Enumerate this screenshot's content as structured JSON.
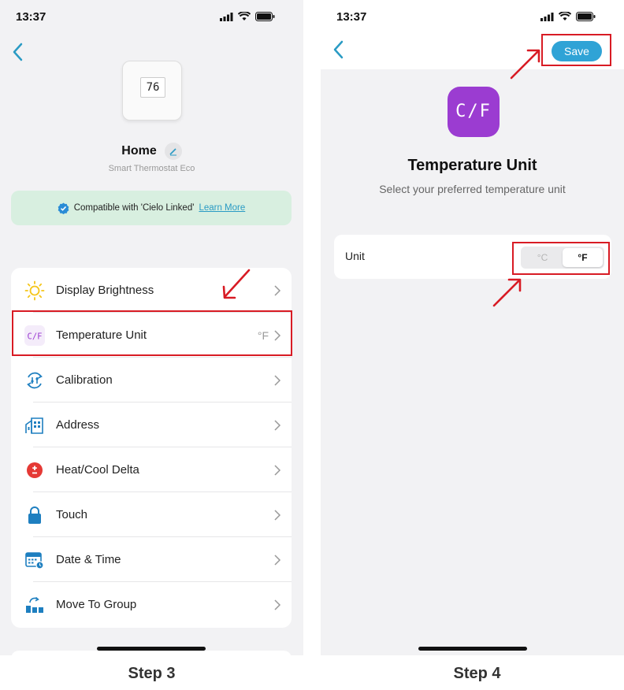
{
  "left": {
    "status": {
      "time": "13:37"
    },
    "device": {
      "screen_temp": "76",
      "name": "Home",
      "model": "Smart Thermostat Eco"
    },
    "compat": {
      "text": "Compatible with 'Cielo Linked'",
      "link": "Learn More"
    },
    "menu": [
      {
        "label": "Display Brightness",
        "icon": "sun-icon",
        "value": ""
      },
      {
        "label": "Temperature Unit",
        "icon": "cf-icon",
        "value": "°F"
      },
      {
        "label": "Calibration",
        "icon": "calibration-icon",
        "value": ""
      },
      {
        "label": "Address",
        "icon": "building-icon",
        "value": ""
      },
      {
        "label": "Heat/Cool Delta",
        "icon": "plus-minus-icon",
        "value": ""
      },
      {
        "label": "Touch",
        "icon": "lock-icon",
        "value": ""
      },
      {
        "label": "Date & Time",
        "icon": "calendar-icon",
        "value": ""
      },
      {
        "label": "Move To Group",
        "icon": "move-group-icon",
        "value": ""
      }
    ],
    "step": "Step 3"
  },
  "right": {
    "status": {
      "time": "13:37"
    },
    "save_label": "Save",
    "cf_icon_text": "C/F",
    "title": "Temperature Unit",
    "subtitle": "Select your preferred temperature unit",
    "unit_label": "Unit",
    "options": [
      "°C",
      "°F"
    ],
    "selected": "°F",
    "step": "Step 4"
  },
  "colors": {
    "accent": "#2fa3d6",
    "cf_purple": "#9b3cd1",
    "highlight": "#d81b24",
    "compat_bg": "#d8efe0"
  }
}
